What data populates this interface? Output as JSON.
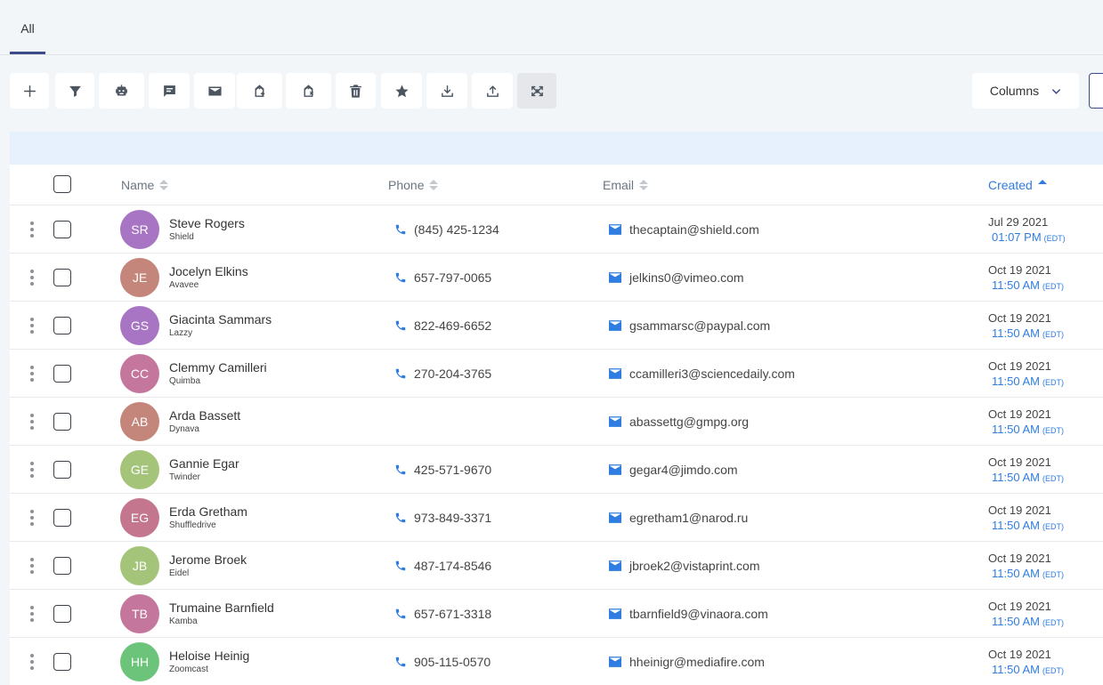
{
  "tabs": [
    {
      "label": "All"
    }
  ],
  "toolbar": {
    "buttons": [
      {
        "icon": "plus-icon"
      },
      {
        "icon": "filter-icon"
      },
      {
        "icon": "robot-icon"
      },
      {
        "icon": "chat-icon"
      },
      {
        "icon": "mail-icon"
      },
      {
        "icon": "tag-add-icon"
      },
      {
        "icon": "tag-remove-icon"
      },
      {
        "icon": "trash-icon"
      },
      {
        "icon": "star-icon"
      },
      {
        "icon": "download-icon"
      },
      {
        "icon": "upload-icon"
      },
      {
        "icon": "fullscreen-icon"
      }
    ],
    "columns_label": "Columns"
  },
  "table": {
    "headers": {
      "name": "Name",
      "phone": "Phone",
      "email": "Email",
      "created": "Created"
    },
    "rows": [
      {
        "initials": "SR",
        "name": "Steve Rogers",
        "company": "Shield",
        "phone": "(845) 425-1234",
        "email": "thecaptain@shield.com",
        "date": "Jul 29 2021",
        "time": "01:07 PM",
        "tz": "(EDT)",
        "color": "#a874c4"
      },
      {
        "initials": "JE",
        "name": "Jocelyn Elkins",
        "company": "Avavee",
        "phone": "657-797-0065",
        "email": "jelkins0@vimeo.com",
        "date": "Oct 19 2021",
        "time": "11:50 AM",
        "tz": "(EDT)",
        "color": "#c4857a"
      },
      {
        "initials": "GS",
        "name": "Giacinta Sammars",
        "company": "Lazzy",
        "phone": "822-469-6652",
        "email": "gsammarsc@paypal.com",
        "date": "Oct 19 2021",
        "time": "11:50 AM",
        "tz": "(EDT)",
        "color": "#a874c4"
      },
      {
        "initials": "CC",
        "name": "Clemmy Camilleri",
        "company": "Quimba",
        "phone": "270-204-3765",
        "email": "ccamilleri3@sciencedaily.com",
        "date": "Oct 19 2021",
        "time": "11:50 AM",
        "tz": "(EDT)",
        "color": "#c4769c"
      },
      {
        "initials": "AB",
        "name": "Arda Bassett",
        "company": "Dynava",
        "phone": "",
        "email": "abassettg@gmpg.org",
        "date": "Oct 19 2021",
        "time": "11:50 AM",
        "tz": "(EDT)",
        "color": "#c4857a"
      },
      {
        "initials": "GE",
        "name": "Gannie Egar",
        "company": "Twinder",
        "phone": "425-571-9670",
        "email": "gegar4@jimdo.com",
        "date": "Oct 19 2021",
        "time": "11:50 AM",
        "tz": "(EDT)",
        "color": "#a4c47a"
      },
      {
        "initials": "EG",
        "name": "Erda Gretham",
        "company": "Shuffledrive",
        "phone": "973-849-3371",
        "email": "egretham1@narod.ru",
        "date": "Oct 19 2021",
        "time": "11:50 AM",
        "tz": "(EDT)",
        "color": "#c4768e"
      },
      {
        "initials": "JB",
        "name": "Jerome Broek",
        "company": "Eidel",
        "phone": "487-174-8546",
        "email": "jbroek2@vistaprint.com",
        "date": "Oct 19 2021",
        "time": "11:50 AM",
        "tz": "(EDT)",
        "color": "#a4c47a"
      },
      {
        "initials": "TB",
        "name": "Trumaine Barnfield",
        "company": "Kamba",
        "phone": "657-671-3318",
        "email": "tbarnfield9@vinaora.com",
        "date": "Oct 19 2021",
        "time": "11:50 AM",
        "tz": "(EDT)",
        "color": "#c4769c"
      },
      {
        "initials": "HH",
        "name": "Heloise Heinig",
        "company": "Zoomcast",
        "phone": "905-115-0570",
        "email": "hheinigr@mediafire.com",
        "date": "Oct 19 2021",
        "time": "11:50 AM",
        "tz": "(EDT)",
        "color": "#6cc47a"
      }
    ]
  }
}
